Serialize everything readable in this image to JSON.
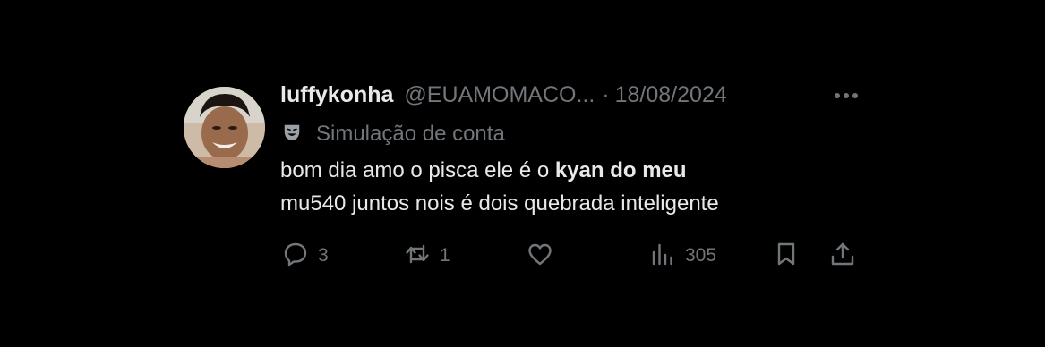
{
  "tweet": {
    "display_name": "luffykonha",
    "handle": "@EUAMOMACO...",
    "separator": "·",
    "date": "18/08/2024",
    "account_label": "Simulação de conta",
    "text_part1": "bom dia amo o pisca ele é o ",
    "text_bold": "kyan do meu",
    "text_line2": "mu540 juntos nois é dois quebrada inteligente"
  },
  "actions": {
    "replies": "3",
    "reposts": "1",
    "views": "305"
  },
  "icons": {
    "more": "more-icon",
    "label": "theater-mask-icon",
    "reply": "reply-icon",
    "repost": "repost-icon",
    "like": "heart-icon",
    "views": "views-icon",
    "bookmark": "bookmark-icon",
    "share": "share-icon"
  },
  "colors": {
    "background": "#000000",
    "text_primary": "#e7e9ea",
    "text_secondary": "#71767b"
  }
}
